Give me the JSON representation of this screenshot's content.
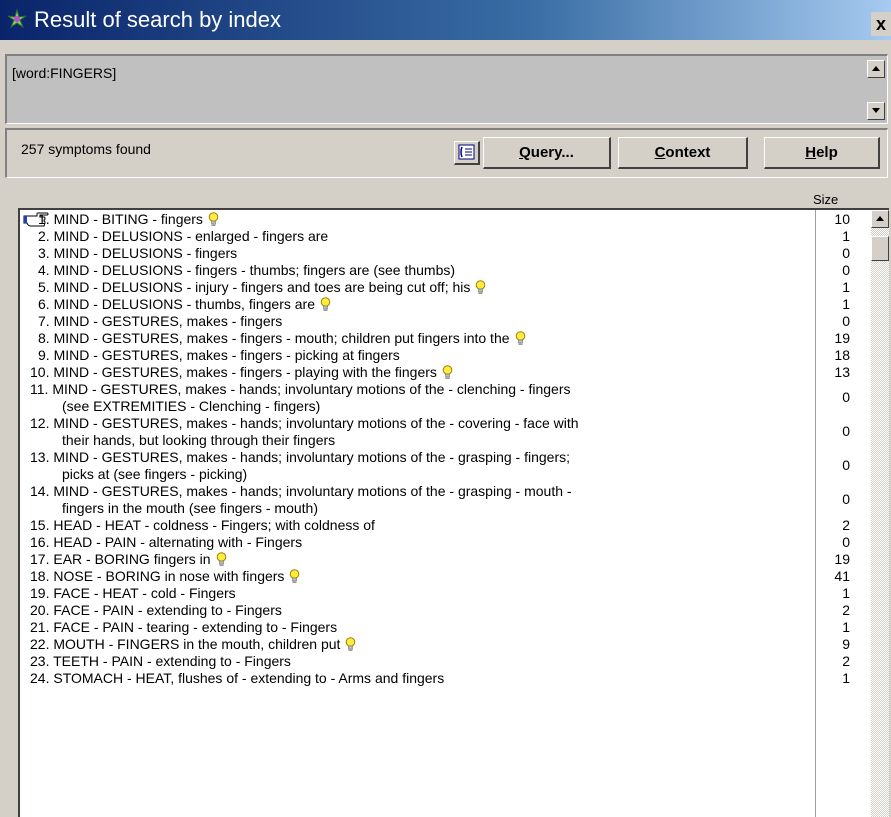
{
  "window": {
    "title": "Result of search by index",
    "close_label": "x"
  },
  "query": {
    "text": "[word:FINGERS]"
  },
  "toolbar": {
    "found_text": "257 symptoms found",
    "query_label_u": "Q",
    "query_label_rest": "uery...",
    "context_label_u": "C",
    "context_label_rest": "ontext",
    "help_label_u": "H",
    "help_label_rest": "elp"
  },
  "list": {
    "size_header": "Size",
    "rows": [
      {
        "num": "1.",
        "text": "MIND - BITING - fingers",
        "bulb": true,
        "size": "10",
        "selected": true
      },
      {
        "num": "2.",
        "text": "MIND - DELUSIONS - enlarged - fingers are",
        "bulb": false,
        "size": "1"
      },
      {
        "num": "3.",
        "text": "MIND - DELUSIONS - fingers",
        "bulb": false,
        "size": "0"
      },
      {
        "num": "4.",
        "text": "MIND - DELUSIONS - fingers - thumbs; fingers are (see thumbs)",
        "bulb": false,
        "size": "0"
      },
      {
        "num": "5.",
        "text": "MIND - DELUSIONS - injury - fingers and toes are being cut off; his",
        "bulb": true,
        "size": "1"
      },
      {
        "num": "6.",
        "text": "MIND - DELUSIONS - thumbs, fingers are",
        "bulb": true,
        "size": "1"
      },
      {
        "num": "7.",
        "text": "MIND - GESTURES, makes - fingers",
        "bulb": false,
        "size": "0"
      },
      {
        "num": "8.",
        "text": "MIND - GESTURES, makes - fingers - mouth; children put fingers into the",
        "bulb": true,
        "size": "19"
      },
      {
        "num": "9.",
        "text": "MIND - GESTURES, makes - fingers - picking at fingers",
        "bulb": false,
        "size": "18"
      },
      {
        "num": "10.",
        "text": "MIND - GESTURES, makes - fingers - playing with the fingers",
        "bulb": true,
        "size": "13"
      },
      {
        "num": "11.",
        "text": "MIND - GESTURES, makes - hands; involuntary motions of the - clenching - fingers",
        "text2": "(see EXTREMITIES - Clenching - fingers)",
        "bulb": false,
        "size": "0"
      },
      {
        "num": "12.",
        "text": "MIND - GESTURES, makes - hands; involuntary motions of the - covering - face with",
        "text2": "their hands, but looking through their fingers",
        "bulb": false,
        "size": "0"
      },
      {
        "num": "13.",
        "text": "MIND - GESTURES, makes - hands; involuntary motions of the - grasping - fingers;",
        "text2": "picks at (see fingers - picking)",
        "bulb": false,
        "size": "0"
      },
      {
        "num": "14.",
        "text": "MIND - GESTURES, makes - hands; involuntary motions of the - grasping - mouth -",
        "text2": "fingers in the mouth (see fingers - mouth)",
        "bulb": false,
        "size": "0"
      },
      {
        "num": "15.",
        "text": "HEAD - HEAT - coldness - Fingers; with coldness of",
        "bulb": false,
        "size": "2"
      },
      {
        "num": "16.",
        "text": "HEAD - PAIN - alternating with - Fingers",
        "bulb": false,
        "size": "0"
      },
      {
        "num": "17.",
        "text": "EAR - BORING fingers in",
        "bulb": true,
        "size": "19"
      },
      {
        "num": "18.",
        "text": "NOSE - BORING in nose with fingers",
        "bulb": true,
        "size": "41"
      },
      {
        "num": "19.",
        "text": "FACE - HEAT - cold - Fingers",
        "bulb": false,
        "size": "1"
      },
      {
        "num": "20.",
        "text": "FACE - PAIN - extending to - Fingers",
        "bulb": false,
        "size": "2"
      },
      {
        "num": "21.",
        "text": "FACE - PAIN - tearing - extending to - Fingers",
        "bulb": false,
        "size": "1"
      },
      {
        "num": "22.",
        "text": "MOUTH - FINGERS in the mouth, children put",
        "bulb": true,
        "size": "9"
      },
      {
        "num": "23.",
        "text": "TEETH - PAIN - extending to - Fingers",
        "bulb": false,
        "size": "2"
      },
      {
        "num": "24.",
        "text": "STOMACH - HEAT, flushes of - extending to - Arms and fingers",
        "bulb": false,
        "size": "1"
      }
    ]
  },
  "icons": {
    "title": "app-icon",
    "pointer": "pointing-hand-icon",
    "hint": "lightbulb-icon",
    "list_view": "list-view-icon"
  }
}
